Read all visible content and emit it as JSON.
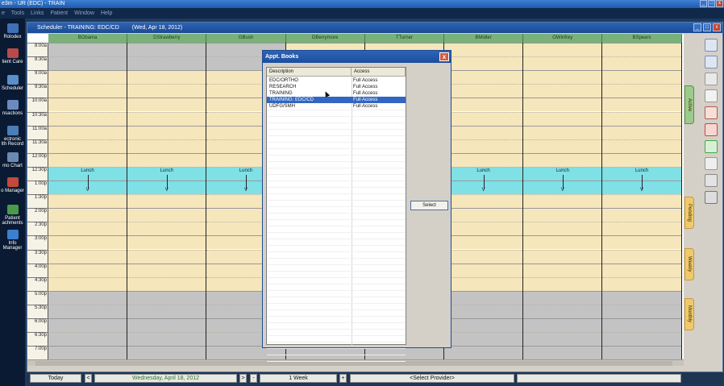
{
  "app": {
    "title": "e3m - UR (EDC) - TRAIN",
    "menu": [
      "e",
      "Tools",
      "Links",
      "Patient",
      "Window",
      "Help"
    ],
    "window_buttons": [
      "_",
      "□",
      "x"
    ]
  },
  "left_nav": [
    {
      "label": "Rolodex",
      "icon": "rolodex-icon"
    },
    {
      "label": "tient Care",
      "icon": "patient-care-icon"
    },
    {
      "label": "Scheduler",
      "icon": "scheduler-icon"
    },
    {
      "label": "nsactions",
      "icon": "transactions-icon"
    },
    {
      "label": "ectronic\nlth Record",
      "icon": "electronic-health-record-icon"
    },
    {
      "label": "mo Chart",
      "icon": "memo-chart-icon"
    },
    {
      "label": "o Manager",
      "icon": "memo-manager-icon"
    },
    {
      "label": "Patient\nachments",
      "icon": "patient-attachments-icon"
    },
    {
      "label": "Info\nManager",
      "icon": "info-manager-icon"
    }
  ],
  "scheduler": {
    "title": "Scheduler - TRAINING:  EDC/CD",
    "date_title": "(Wed, Apr 18, 2012)",
    "providers": [
      "BObama",
      "DStrawberry",
      "GBush",
      "DBerrymore",
      "TTurner",
      "BMidler",
      "OWinfrey",
      "BSpears"
    ],
    "times": [
      "8:00a",
      "8:30a",
      "9:00a",
      "9:30a",
      "10:00a",
      "10:30a",
      "11:00a",
      "11:30a",
      "12:00p",
      "12:30p",
      "1:00p",
      "1:30p",
      "2:00p",
      "2:30p",
      "3:00p",
      "3:30p",
      "4:00p",
      "4:30p",
      "5:00p",
      "5:30p",
      "6:00p",
      "6:30p",
      "7:00p"
    ],
    "lunch_label": "Lunch",
    "lunch_end_mark": "V",
    "side_tabs": [
      "Active",
      "Pending",
      "Weekly",
      "Monthly"
    ],
    "colors": {
      "open": "#f5e6bc",
      "closed": "#c3c3c3",
      "lunch": "#7fe0e5",
      "header": "#7ab07a"
    }
  },
  "bottom_bar": {
    "today": "Today",
    "prev": "<",
    "date": "Wednesday, April 18, 2012",
    "date_next": ">",
    "minus": "-",
    "view": "1 Week",
    "plus": "+",
    "provider": "<Select Provider>",
    "blank": ""
  },
  "dialog": {
    "title": "Appt. Books",
    "close": "x",
    "columns": [
      "Description",
      "Access"
    ],
    "rows": [
      {
        "description": "EDC/ORTHO",
        "access": "Full Access",
        "selected": false
      },
      {
        "description": "RESEARCH",
        "access": "Full Access",
        "selected": false
      },
      {
        "description": "TRAINING",
        "access": "Full Access",
        "selected": false
      },
      {
        "description": "TRAINING: EDC/CD",
        "access": "Full Access",
        "selected": true
      },
      {
        "description": "UDFG/SMH",
        "access": "Full Access",
        "selected": false
      }
    ],
    "select_button": "Select"
  }
}
